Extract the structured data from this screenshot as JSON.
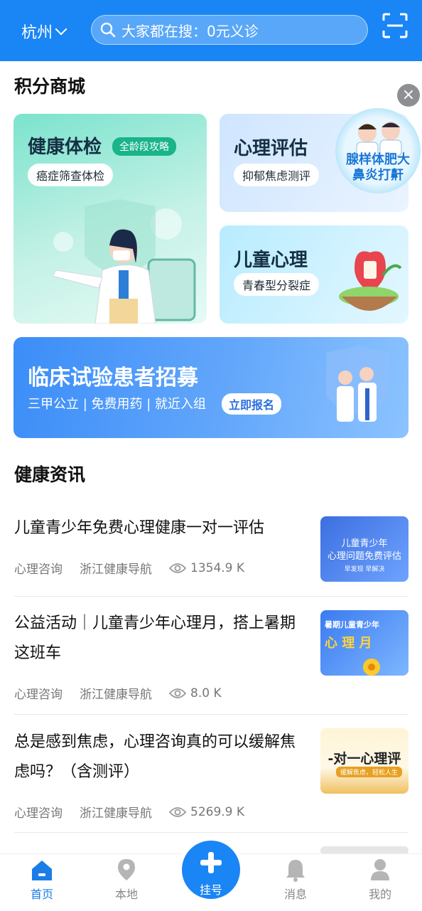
{
  "header": {
    "city": "杭州",
    "search_placeholder": "大家都在搜：0元义诊"
  },
  "mall": {
    "title": "积分商城",
    "health_check": {
      "title": "健康体检",
      "tag": "全龄段攻略",
      "sub": "癌症筛查体检"
    },
    "psych_eval": {
      "title": "心理评估",
      "sub": "抑郁焦虑测评"
    },
    "child_psych": {
      "title": "儿童心理",
      "sub": "青春型分裂症"
    },
    "float_ad": {
      "text": "腺样体肥大 鼻炎打鼾"
    },
    "close_symbol": "×"
  },
  "banner": {
    "title": "临床试验患者招募",
    "subtitle": "三甲公立 | 免费用药 | 就近入组",
    "button": "立即报名"
  },
  "news": {
    "title": "健康资讯",
    "items": [
      {
        "title": "儿童青少年免费心理健康一对一评估",
        "category": "心理咨询",
        "source": "浙江健康导航",
        "views": "1354.9 K",
        "thumb_lines": [
          "儿童青少年",
          "心理问题免费评估",
          "早发现 早解决"
        ]
      },
      {
        "title": "公益活动｜儿童青少年心理月，搭上暑期这班车",
        "category": "心理咨询",
        "source": "浙江健康导航",
        "views": "8.0 K",
        "thumb_lines": [
          "暑期儿童青少年",
          "心 理 月"
        ]
      },
      {
        "title": "总是感到焦虑，心理咨询真的可以缓解焦虑吗？（含测评）",
        "category": "心理咨询",
        "source": "浙江健康导航",
        "views": "5269.9 K",
        "thumb_lines": [
          "-对一心理评",
          "缓解焦虑，轻松人生"
        ]
      }
    ]
  },
  "tabbar": {
    "home": "首页",
    "local": "本地",
    "register": "挂号",
    "messages": "消息",
    "mine": "我的"
  }
}
